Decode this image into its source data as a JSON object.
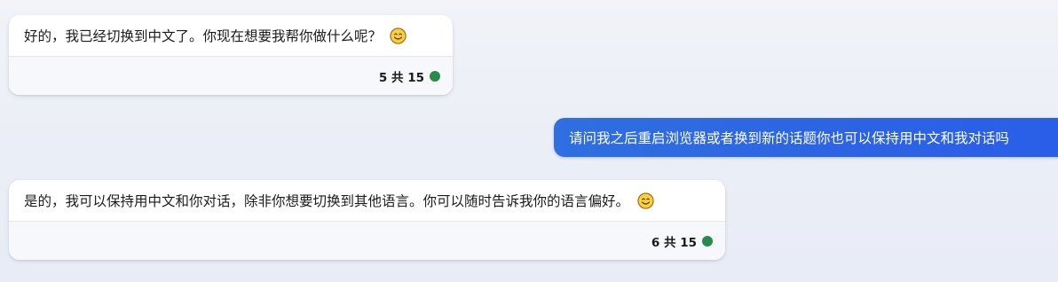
{
  "messages": {
    "bot_1": {
      "text": "好的，我已经切换到中文了。你现在想要我帮你做什么呢？",
      "emoji_icon": "smiling-face-emoji",
      "counter": "5 共 15",
      "status_color": "#2a8a4a"
    },
    "user_1": {
      "text": "请问我之后重启浏览器或者换到新的话题你也可以保持用中文和我对话吗"
    },
    "bot_2": {
      "text": "是的，我可以保持用中文和你对话，除非你想要切换到其他语言。你可以随时告诉我你的语言偏好。",
      "emoji_icon": "smiling-face-emoji",
      "counter": "6 共 15",
      "status_color": "#2a8a4a"
    }
  },
  "colors": {
    "user_bubble": "#2c63e4",
    "bot_bubble": "#ffffff",
    "status_dot": "#2a8a4a"
  }
}
